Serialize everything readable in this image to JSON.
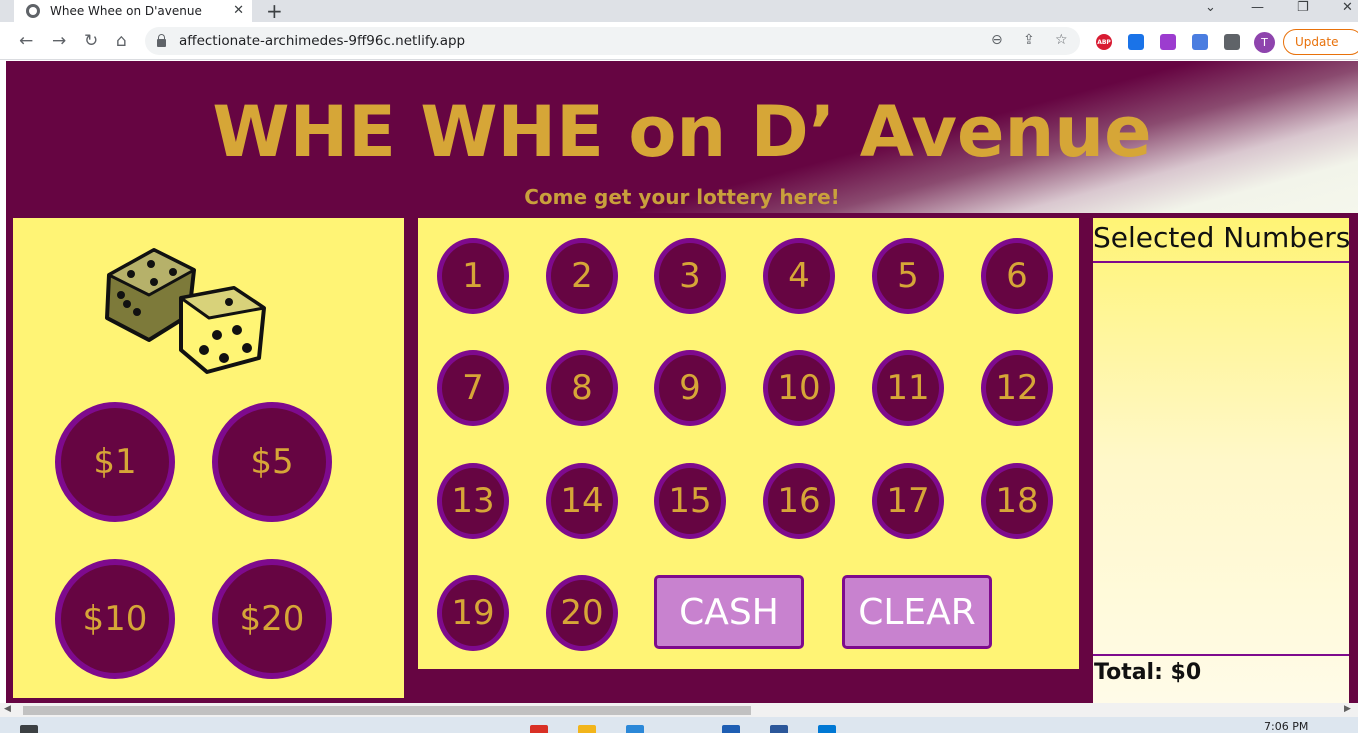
{
  "browser": {
    "tab_title": "Whee Whee on D'avenue",
    "tab_close": "✕",
    "new_tab": "+",
    "url": "affectionate-archimedes-9ff96c.netlify.app",
    "profile_initial": "T",
    "update_label": "Update",
    "abp_label": "ABP",
    "window_minimize": "—",
    "window_restore": "❐",
    "window_close": "✕",
    "window_tabs_menu": "⌄"
  },
  "header": {
    "title": "WHE WHE on D’ Avenue",
    "subtitle": "Come get your lottery here!"
  },
  "bets": [
    "$1",
    "$5",
    "$10",
    "$20"
  ],
  "numbers": [
    "1",
    "2",
    "3",
    "4",
    "5",
    "6",
    "7",
    "8",
    "9",
    "10",
    "11",
    "12",
    "13",
    "14",
    "15",
    "16",
    "17",
    "18",
    "19",
    "20"
  ],
  "actions": {
    "cash": "CASH",
    "clear": "CLEAR"
  },
  "selected": {
    "title": "Selected Numbers",
    "total": "Total: $0"
  },
  "taskbar": {
    "time": "7:06 PM"
  },
  "colors": {
    "page_bg": "#660542",
    "panel_yellow": "#fff475",
    "gold_text": "#d6a637",
    "ring_purple": "#7e0a8d",
    "button_lilac": "#c882cf"
  }
}
